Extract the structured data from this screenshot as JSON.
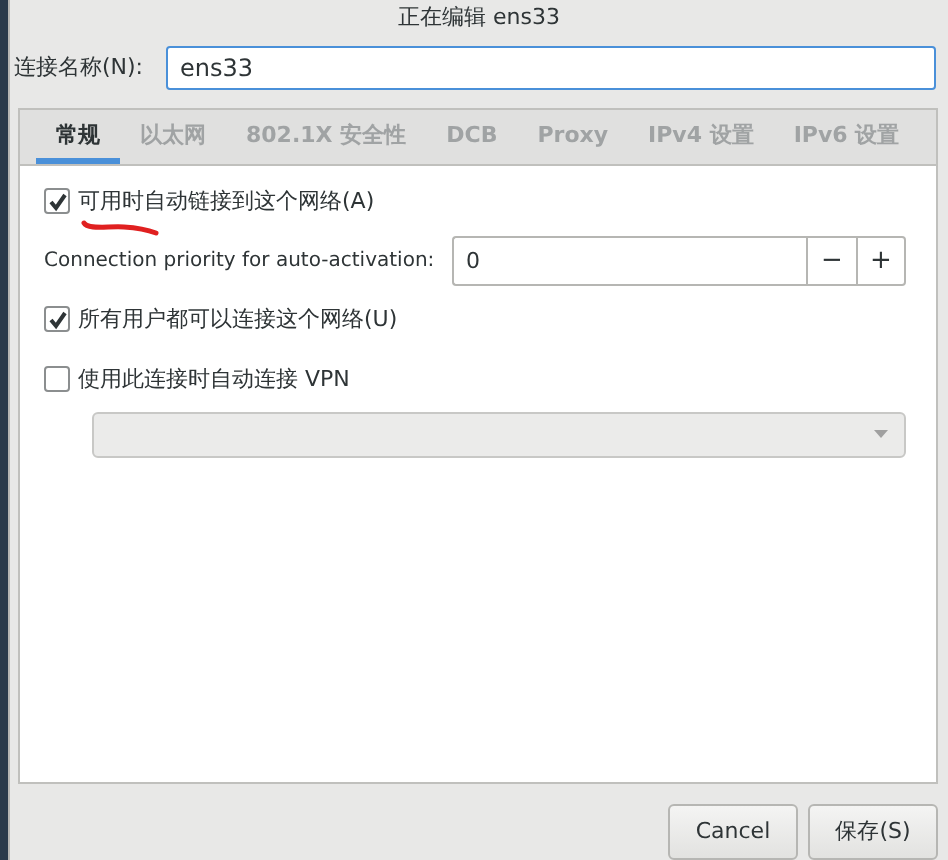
{
  "window": {
    "title": "正在编辑 ens33"
  },
  "connection_name": {
    "label": "连接名称(N):",
    "value": "ens33"
  },
  "tabs": [
    {
      "label": "常规",
      "selected": true
    },
    {
      "label": "以太网",
      "selected": false
    },
    {
      "label": "802.1X 安全性",
      "selected": false
    },
    {
      "label": "DCB",
      "selected": false
    },
    {
      "label": "Proxy",
      "selected": false
    },
    {
      "label": "IPv4 设置",
      "selected": false
    },
    {
      "label": "IPv6 设置",
      "selected": false
    }
  ],
  "auto_connect": {
    "label": "可用时自动链接到这个网络(A)",
    "checked": true
  },
  "priority": {
    "label": "Connection priority for auto-activation:",
    "value": "0",
    "decrement": "−",
    "increment": "+"
  },
  "all_users": {
    "label": "所有用户都可以连接这个网络(U)",
    "checked": true
  },
  "auto_vpn": {
    "label": "使用此连接时自动连接 VPN",
    "checked": false
  },
  "vpn_select": {
    "disabled": true
  },
  "buttons": [
    {
      "label": "Cancel"
    },
    {
      "label": "保存(S)"
    }
  ]
}
